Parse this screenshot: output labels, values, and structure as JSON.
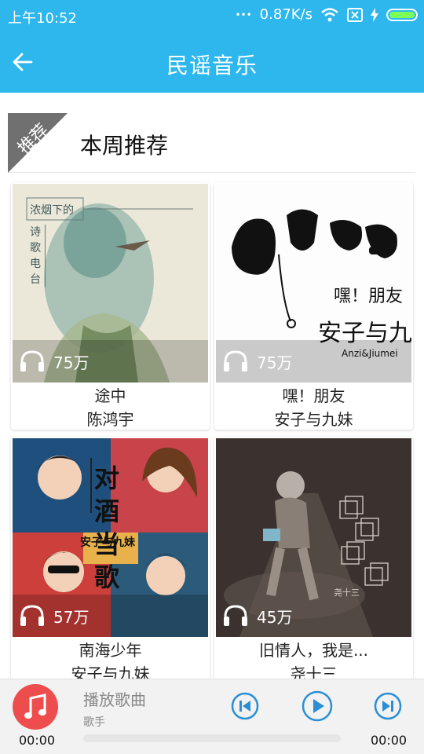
{
  "status": {
    "time": "上午10:52",
    "speed": "0.87K/s",
    "dots": "•••",
    "battery_level": 1.0
  },
  "appbar": {
    "title": "民谣音乐",
    "back_icon": "arrow-left-icon"
  },
  "section": {
    "ribbon": "推荐",
    "title": "本周推荐"
  },
  "cards": [
    {
      "plays": "75万",
      "name": "途中",
      "artist": "陈鸿宇",
      "cover_text": "浓烟下的",
      "cover_sub": "诗歌电台"
    },
    {
      "plays": "75万",
      "name": "嘿！朋友",
      "artist": "安子与九妹",
      "cover_text": "嘿！朋友",
      "cover_sub": "安子与九妹",
      "cover_en": "Anzi&Jiumei"
    },
    {
      "plays": "57万",
      "name": "南海少年",
      "artist": "安子与九妹",
      "cover_text": "对酒当歌",
      "cover_sub": "安子与九妹"
    },
    {
      "plays": "45万",
      "name": "旧情人，我是...",
      "artist": "尧十三",
      "cover_text": "尧十三"
    }
  ],
  "player": {
    "song": "播放歌曲",
    "singer": "歌手",
    "current": "00:00",
    "total": "00:00",
    "progress": 0
  },
  "colors": {
    "primary": "#2db7ec",
    "accent": "#ee4d4d",
    "control": "#2a8fd6"
  }
}
